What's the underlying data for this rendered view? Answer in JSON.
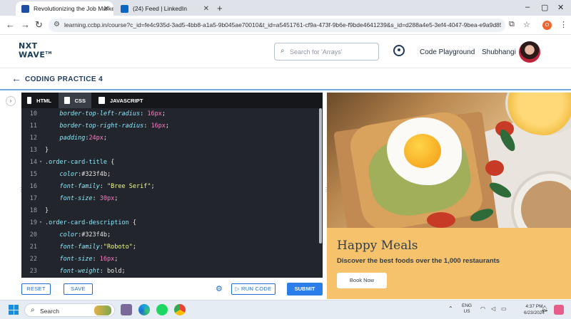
{
  "browser": {
    "tabs": [
      {
        "title": "Revolutionizing the Job Market",
        "active": true,
        "favicon_color": "#1f4ea3"
      },
      {
        "title": "(24) Feed | LinkedIn",
        "active": false,
        "favicon_color": "#0a66c2"
      }
    ],
    "new_tab": "+",
    "window_controls": {
      "minimize": "–",
      "maximize": "▢",
      "close": "✕"
    },
    "url": "learning.ccbp.in/course?c_id=fe4c935d-3ad5-4bb8-a1a5-9b045ae70010&t_id=a5451761-cf9a-473f-9b6e-f9bde4641239&s_id=d288a4e5-3ef4-4047-9bea-e9a9d851116f",
    "profile_initial": "O",
    "icons": [
      "back-icon",
      "forward-icon",
      "reload-icon",
      "tune-icon",
      "cast-icon",
      "star-icon",
      "profile-icon",
      "menu-icon"
    ]
  },
  "header": {
    "logo_line1": "NXT",
    "logo_line2": "WAVE",
    "logo_tm": "TM",
    "search_placeholder": "Search for 'Arrays'",
    "code_playground": "Code Playground",
    "user_name": "Shubhangi"
  },
  "practice": {
    "title": "CODING PRACTICE 4"
  },
  "editor": {
    "tabs": [
      {
        "label": "HTML",
        "active": false
      },
      {
        "label": "CSS",
        "active": true
      },
      {
        "label": "JAVASCRIPT",
        "active": false
      }
    ],
    "lines": [
      {
        "n": "10",
        "fold": "",
        "tokens": [
          {
            "t": "    ",
            "c": "pun"
          },
          {
            "t": "border-top-left-radius",
            "c": "prop"
          },
          {
            "t": ": ",
            "c": "pun"
          },
          {
            "t": "16px",
            "c": "num"
          },
          {
            "t": ";",
            "c": "pun"
          }
        ]
      },
      {
        "n": "11",
        "fold": "",
        "tokens": [
          {
            "t": "    ",
            "c": "pun"
          },
          {
            "t": "border-top-right-radius",
            "c": "prop"
          },
          {
            "t": ": ",
            "c": "pun"
          },
          {
            "t": "16px",
            "c": "num"
          },
          {
            "t": ";",
            "c": "pun"
          }
        ]
      },
      {
        "n": "12",
        "fold": "",
        "tokens": [
          {
            "t": "    ",
            "c": "pun"
          },
          {
            "t": "padding",
            "c": "prop"
          },
          {
            "t": ":",
            "c": "pun"
          },
          {
            "t": "24px",
            "c": "num"
          },
          {
            "t": ";",
            "c": "pun"
          }
        ]
      },
      {
        "n": "13",
        "fold": "",
        "tokens": [
          {
            "t": "}",
            "c": "pun"
          }
        ]
      },
      {
        "n": "14",
        "fold": "▾",
        "tokens": [
          {
            "t": ".order-card-title",
            "c": "sel"
          },
          {
            "t": " {",
            "c": "pun"
          }
        ]
      },
      {
        "n": "15",
        "fold": "",
        "tokens": [
          {
            "t": "    ",
            "c": "pun"
          },
          {
            "t": "color",
            "c": "prop"
          },
          {
            "t": ":#323f4b;",
            "c": "pun"
          }
        ]
      },
      {
        "n": "16",
        "fold": "",
        "tokens": [
          {
            "t": "    ",
            "c": "pun"
          },
          {
            "t": "font-family",
            "c": "prop"
          },
          {
            "t": ": ",
            "c": "pun"
          },
          {
            "t": "\"Bree Serif\"",
            "c": "str"
          },
          {
            "t": ";",
            "c": "pun"
          }
        ]
      },
      {
        "n": "17",
        "fold": "",
        "tokens": [
          {
            "t": "    ",
            "c": "pun"
          },
          {
            "t": "font-size",
            "c": "prop"
          },
          {
            "t": ": ",
            "c": "pun"
          },
          {
            "t": "30px",
            "c": "num"
          },
          {
            "t": ";",
            "c": "pun"
          }
        ]
      },
      {
        "n": "18",
        "fold": "",
        "tokens": [
          {
            "t": "}",
            "c": "pun"
          }
        ]
      },
      {
        "n": "19",
        "fold": "▾",
        "tokens": [
          {
            "t": ".order-card-description",
            "c": "sel"
          },
          {
            "t": " {",
            "c": "pun"
          }
        ]
      },
      {
        "n": "20",
        "fold": "",
        "tokens": [
          {
            "t": "    ",
            "c": "pun"
          },
          {
            "t": "color",
            "c": "prop"
          },
          {
            "t": ":#323f4b;",
            "c": "pun"
          }
        ]
      },
      {
        "n": "21",
        "fold": "",
        "tokens": [
          {
            "t": "    ",
            "c": "pun"
          },
          {
            "t": "font-family",
            "c": "prop"
          },
          {
            "t": ":",
            "c": "pun"
          },
          {
            "t": "\"Roboto\"",
            "c": "str"
          },
          {
            "t": ";",
            "c": "pun"
          }
        ]
      },
      {
        "n": "22",
        "fold": "",
        "tokens": [
          {
            "t": "    ",
            "c": "pun"
          },
          {
            "t": "font-size",
            "c": "prop"
          },
          {
            "t": ": ",
            "c": "pun"
          },
          {
            "t": "16px",
            "c": "num"
          },
          {
            "t": ";",
            "c": "pun"
          }
        ]
      },
      {
        "n": "23",
        "fold": "",
        "tokens": [
          {
            "t": "    ",
            "c": "pun"
          },
          {
            "t": "font-weight",
            "c": "prop"
          },
          {
            "t": ": bold;",
            "c": "pun"
          }
        ]
      }
    ],
    "buttons": {
      "reset": "RESET",
      "save": "SAVE",
      "run": "▷ RUN CODE",
      "submit": "SUBMIT"
    }
  },
  "preview": {
    "card_title": "Happy Meals",
    "card_description": "Discover the best foods over the 1,000 restaurants",
    "book_button": "Book Now"
  },
  "taskbar": {
    "search_label": "Search",
    "lang_line1": "ENG",
    "lang_line2": "US",
    "time": "4:37 PM",
    "date": "6/23/2024"
  }
}
